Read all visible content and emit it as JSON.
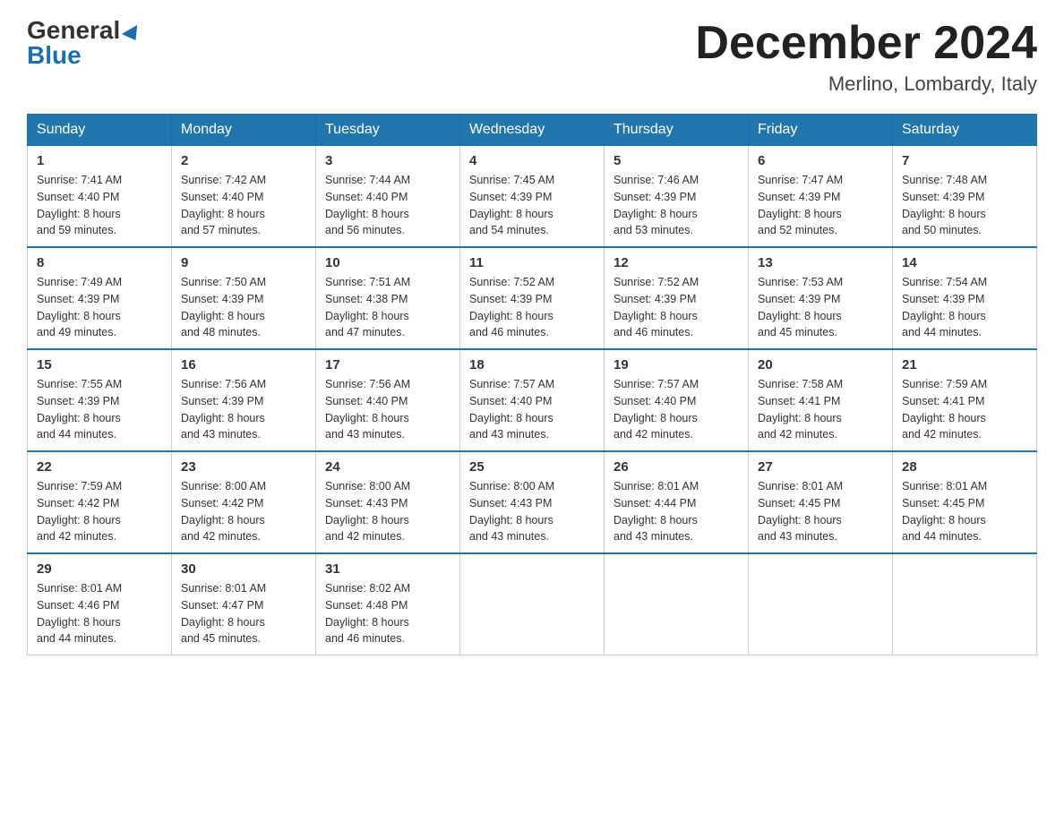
{
  "header": {
    "logo_general": "General",
    "logo_blue": "Blue",
    "month_title": "December 2024",
    "location": "Merlino, Lombardy, Italy"
  },
  "days_of_week": [
    "Sunday",
    "Monday",
    "Tuesday",
    "Wednesday",
    "Thursday",
    "Friday",
    "Saturday"
  ],
  "weeks": [
    [
      {
        "day": "1",
        "sunrise": "7:41 AM",
        "sunset": "4:40 PM",
        "daylight": "8 hours and 59 minutes."
      },
      {
        "day": "2",
        "sunrise": "7:42 AM",
        "sunset": "4:40 PM",
        "daylight": "8 hours and 57 minutes."
      },
      {
        "day": "3",
        "sunrise": "7:44 AM",
        "sunset": "4:40 PM",
        "daylight": "8 hours and 56 minutes."
      },
      {
        "day": "4",
        "sunrise": "7:45 AM",
        "sunset": "4:39 PM",
        "daylight": "8 hours and 54 minutes."
      },
      {
        "day": "5",
        "sunrise": "7:46 AM",
        "sunset": "4:39 PM",
        "daylight": "8 hours and 53 minutes."
      },
      {
        "day": "6",
        "sunrise": "7:47 AM",
        "sunset": "4:39 PM",
        "daylight": "8 hours and 52 minutes."
      },
      {
        "day": "7",
        "sunrise": "7:48 AM",
        "sunset": "4:39 PM",
        "daylight": "8 hours and 50 minutes."
      }
    ],
    [
      {
        "day": "8",
        "sunrise": "7:49 AM",
        "sunset": "4:39 PM",
        "daylight": "8 hours and 49 minutes."
      },
      {
        "day": "9",
        "sunrise": "7:50 AM",
        "sunset": "4:39 PM",
        "daylight": "8 hours and 48 minutes."
      },
      {
        "day": "10",
        "sunrise": "7:51 AM",
        "sunset": "4:38 PM",
        "daylight": "8 hours and 47 minutes."
      },
      {
        "day": "11",
        "sunrise": "7:52 AM",
        "sunset": "4:39 PM",
        "daylight": "8 hours and 46 minutes."
      },
      {
        "day": "12",
        "sunrise": "7:52 AM",
        "sunset": "4:39 PM",
        "daylight": "8 hours and 46 minutes."
      },
      {
        "day": "13",
        "sunrise": "7:53 AM",
        "sunset": "4:39 PM",
        "daylight": "8 hours and 45 minutes."
      },
      {
        "day": "14",
        "sunrise": "7:54 AM",
        "sunset": "4:39 PM",
        "daylight": "8 hours and 44 minutes."
      }
    ],
    [
      {
        "day": "15",
        "sunrise": "7:55 AM",
        "sunset": "4:39 PM",
        "daylight": "8 hours and 44 minutes."
      },
      {
        "day": "16",
        "sunrise": "7:56 AM",
        "sunset": "4:39 PM",
        "daylight": "8 hours and 43 minutes."
      },
      {
        "day": "17",
        "sunrise": "7:56 AM",
        "sunset": "4:40 PM",
        "daylight": "8 hours and 43 minutes."
      },
      {
        "day": "18",
        "sunrise": "7:57 AM",
        "sunset": "4:40 PM",
        "daylight": "8 hours and 43 minutes."
      },
      {
        "day": "19",
        "sunrise": "7:57 AM",
        "sunset": "4:40 PM",
        "daylight": "8 hours and 42 minutes."
      },
      {
        "day": "20",
        "sunrise": "7:58 AM",
        "sunset": "4:41 PM",
        "daylight": "8 hours and 42 minutes."
      },
      {
        "day": "21",
        "sunrise": "7:59 AM",
        "sunset": "4:41 PM",
        "daylight": "8 hours and 42 minutes."
      }
    ],
    [
      {
        "day": "22",
        "sunrise": "7:59 AM",
        "sunset": "4:42 PM",
        "daylight": "8 hours and 42 minutes."
      },
      {
        "day": "23",
        "sunrise": "8:00 AM",
        "sunset": "4:42 PM",
        "daylight": "8 hours and 42 minutes."
      },
      {
        "day": "24",
        "sunrise": "8:00 AM",
        "sunset": "4:43 PM",
        "daylight": "8 hours and 42 minutes."
      },
      {
        "day": "25",
        "sunrise": "8:00 AM",
        "sunset": "4:43 PM",
        "daylight": "8 hours and 43 minutes."
      },
      {
        "day": "26",
        "sunrise": "8:01 AM",
        "sunset": "4:44 PM",
        "daylight": "8 hours and 43 minutes."
      },
      {
        "day": "27",
        "sunrise": "8:01 AM",
        "sunset": "4:45 PM",
        "daylight": "8 hours and 43 minutes."
      },
      {
        "day": "28",
        "sunrise": "8:01 AM",
        "sunset": "4:45 PM",
        "daylight": "8 hours and 44 minutes."
      }
    ],
    [
      {
        "day": "29",
        "sunrise": "8:01 AM",
        "sunset": "4:46 PM",
        "daylight": "8 hours and 44 minutes."
      },
      {
        "day": "30",
        "sunrise": "8:01 AM",
        "sunset": "4:47 PM",
        "daylight": "8 hours and 45 minutes."
      },
      {
        "day": "31",
        "sunrise": "8:02 AM",
        "sunset": "4:48 PM",
        "daylight": "8 hours and 46 minutes."
      },
      null,
      null,
      null,
      null
    ]
  ],
  "labels": {
    "sunrise": "Sunrise: ",
    "sunset": "Sunset: ",
    "daylight": "Daylight: "
  }
}
